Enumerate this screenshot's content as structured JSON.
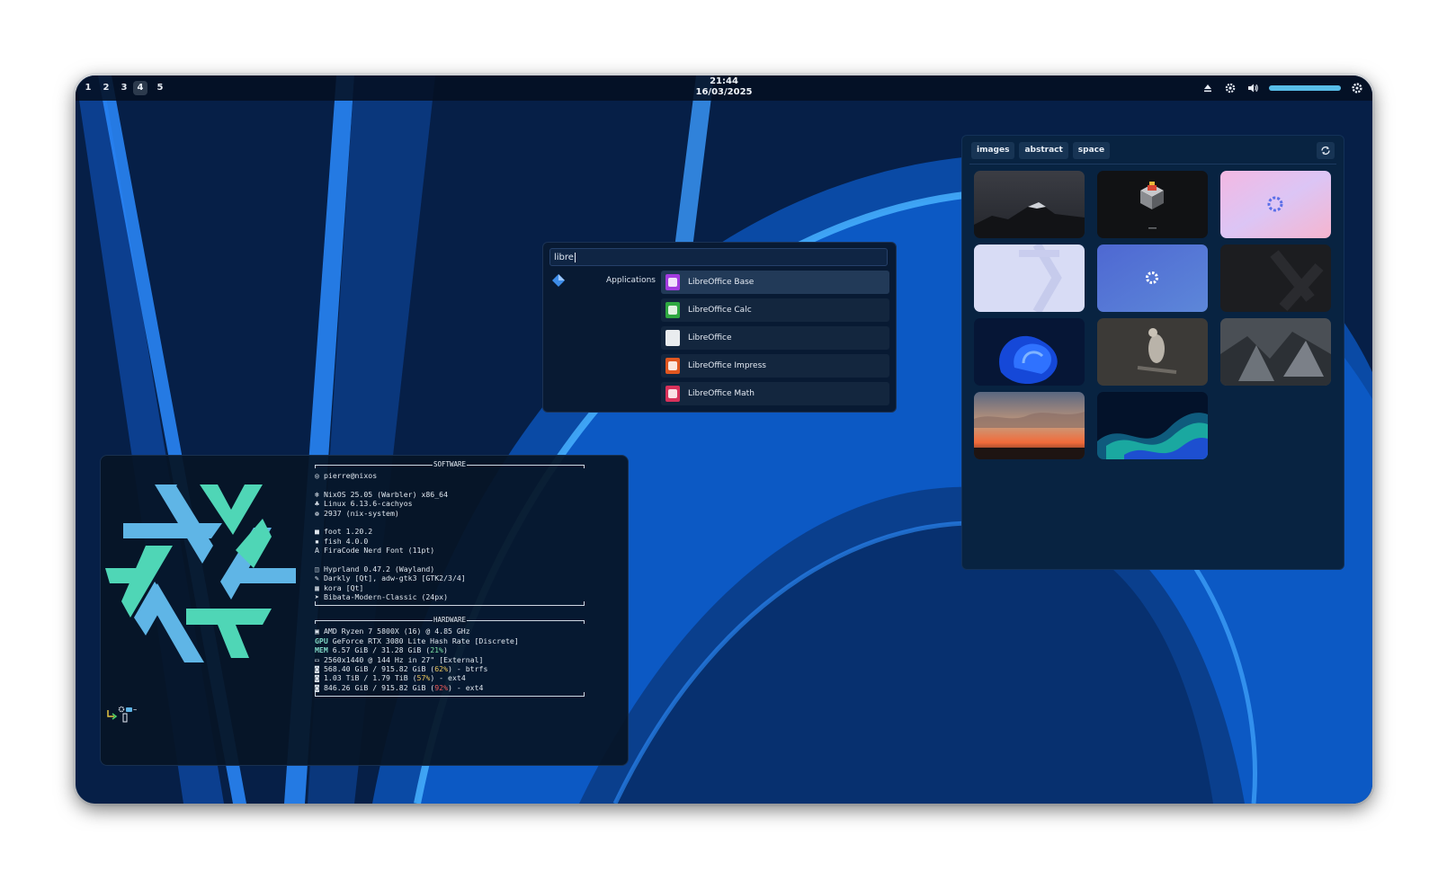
{
  "topbar": {
    "workspaces": [
      "1",
      "2",
      "3",
      "4",
      "5"
    ],
    "active_workspace": "4",
    "time": "21:44",
    "date": "16/03/2025",
    "volume_level": 1.0,
    "icons": [
      "eject-icon",
      "gear-icon",
      "speaker-icon",
      "settings-icon"
    ]
  },
  "launcher": {
    "query": "libre",
    "category": "Applications",
    "category_icon": "diamond-icon",
    "apps": [
      {
        "label": "LibreOffice Base",
        "icon": "libreoffice-base-icon",
        "color": "#a33be0"
      },
      {
        "label": "LibreOffice Calc",
        "icon": "libreoffice-calc-icon",
        "color": "#2fa841"
      },
      {
        "label": "LibreOffice",
        "icon": "libreoffice-icon",
        "color": "#e9ecef"
      },
      {
        "label": "LibreOffice Impress",
        "icon": "libreoffice-impress-icon",
        "color": "#e0561f"
      },
      {
        "label": "LibreOffice Math",
        "icon": "libreoffice-math-icon",
        "color": "#d8315b"
      }
    ]
  },
  "picker": {
    "tabs": [
      "images",
      "abstract",
      "space"
    ],
    "refresh_icon": "refresh-icon"
  },
  "terminal": {
    "software_title": "SOFTWARE",
    "hardware_title": "HARDWARE",
    "user": "pierre@nixos",
    "os": "NixOS 25.05 (Warbler) x86_64",
    "kernel": "Linux 6.13.6-cachyos",
    "packages": "2937 (nix-system)",
    "terminal": "foot 1.20.2",
    "shell": "fish 4.0.0",
    "font": "FiraCode Nerd Font (11pt)",
    "wm": "Hyprland 0.47.2 (Wayland)",
    "theme": "Darkly [Qt], adw-gtk3 [GTK2/3/4]",
    "icons": "kora [Qt]",
    "cursor": "Bibata-Modern-Classic (24px)",
    "cpu": "AMD Ryzen 7 5800X (16) @ 4.85 GHz",
    "gpu_key": "GPU",
    "gpu": "GeForce RTX 3080 Lite Hash Rate [Discrete]",
    "mem_key": "MEM",
    "mem": "6.57 GiB / 31.28 GiB (",
    "mem_pct": "21%",
    "display": "2560x1440 @ 144 Hz in 27\" [External]",
    "disk1": "568.40 GiB / 915.82 GiB (",
    "disk1_pct": "62%",
    "disk1_fs": ") - btrfs",
    "disk2": "1.03 TiB / 1.79 TiB (",
    "disk2_pct": "57%",
    "disk2_fs": ") - ext4",
    "disk3": "846.26 GiB / 915.82 GiB (",
    "disk3_pct": "92%",
    "disk3_fs": ") - ext4",
    "mem_close": ")",
    "prompt_tilde": "~"
  }
}
